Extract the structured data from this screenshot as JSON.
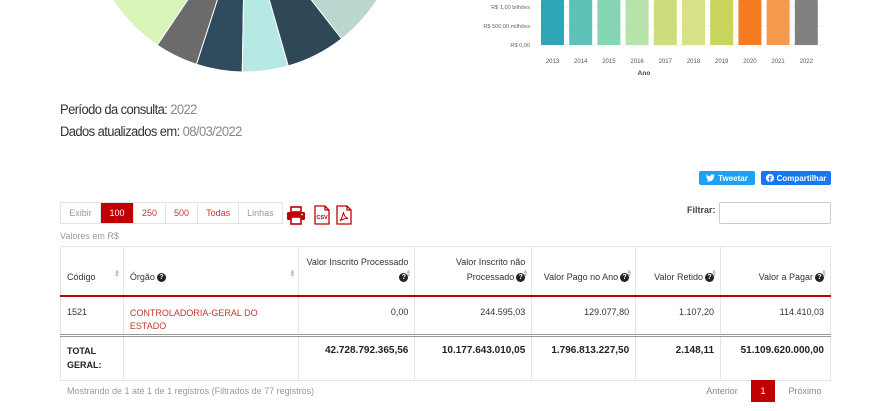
{
  "charts": {
    "bar_currency": "R$",
    "bar_xlabel": "Ano"
  },
  "chart_data": [
    {
      "type": "pie",
      "title": "",
      "slices": [
        {
          "color": "#d8f4b8"
        },
        {
          "color": "#6b6b6b"
        },
        {
          "color": "#2e4a5c"
        },
        {
          "color": "#b6e8e4"
        },
        {
          "color": "#2f4858"
        },
        {
          "color": "#b9d6cf"
        },
        {
          "color": "#d5ead6"
        }
      ]
    },
    {
      "type": "bar",
      "title": "",
      "xlabel": "Ano",
      "ylabel": "",
      "ytick_labels": [
        "R$ 1,00 bilhões",
        "R$ 500,00 milhões",
        "R$ 0,00"
      ],
      "yticks": [
        1000000000,
        500000000,
        0
      ],
      "categories": [
        "2013",
        "2014",
        "2015",
        "2016",
        "2017",
        "2018",
        "2019",
        "2020",
        "2021",
        "2022"
      ],
      "colors": [
        "#2fa6b8",
        "#5cc2b8",
        "#86d6b5",
        "#b6e3a8",
        "#cddc7c",
        "#d9e08a",
        "#c8d45c",
        "#f57c20",
        "#f59a4c",
        "#808080"
      ],
      "values": [
        1250000000,
        1250000000,
        1250000000,
        1250000000,
        1250000000,
        1250000000,
        1250000000,
        1250000000,
        1250000000,
        1250000000
      ],
      "ylim": [
        0,
        1250000000
      ],
      "grid": true
    }
  ],
  "info": {
    "period_label": "Período da consulta:",
    "period_value": "2022",
    "updated_label": "Dados atualizados em:",
    "updated_value": "08/03/2022"
  },
  "share": {
    "tweet_label": "Tweetar",
    "share_label": "Compartilhar"
  },
  "paging": {
    "show_label": "Exibir",
    "options": [
      "100",
      "250",
      "500",
      "Todas"
    ],
    "selected": "100",
    "rows_label": "Linhas"
  },
  "export": {
    "csv_label": "CSV"
  },
  "filter": {
    "label": "Filtrar:",
    "value": ""
  },
  "values_note": "Valores em R$",
  "table": {
    "headers": [
      "Código",
      "Órgão",
      "Valor Inscrito Processado",
      "Valor Inscrito não Processado",
      "Valor Pago no Ano",
      "Valor Retido",
      "Valor a Pagar"
    ],
    "rows": [
      [
        "1521",
        "CONTROLADORIA-GERAL DO ESTADO",
        "0,00",
        "244.595,03",
        "129.077,80",
        "1.107,20",
        "114.410,03"
      ]
    ],
    "footer": {
      "label": "TOTAL GERAL:",
      "values": [
        "42.728.792.365,56",
        "10.177.643.010,05",
        "1.796.813.227,50",
        "2.148,11",
        "51.109.620.000,00"
      ]
    }
  },
  "footer": {
    "results_text": "Mostrando de 1 até 1 de 1 registros (Filtrados de 77 registros)",
    "prev_label": "Anterior",
    "page": "1",
    "next_label": "Próximo"
  }
}
